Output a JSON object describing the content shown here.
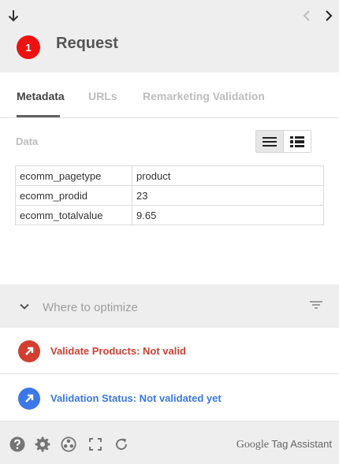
{
  "header": {
    "back_icon": "arrow-down-icon",
    "prev_icon": "chevron-left-icon",
    "next_icon": "chevron-right-icon",
    "badge_number": "1",
    "title": "Request",
    "badge_color": "#ee1111"
  },
  "tabs": [
    {
      "label": "Metadata",
      "active": true
    },
    {
      "label": "URLs",
      "active": false
    },
    {
      "label": "Remarketing Validation",
      "active": false
    }
  ],
  "data_section": {
    "label": "Data",
    "view_modes": [
      "compact-list-icon",
      "detailed-list-icon"
    ],
    "rows": [
      {
        "key": "ecomm_pagetype",
        "value": "product"
      },
      {
        "key": "ecomm_prodid",
        "value": "23"
      },
      {
        "key": "ecomm_totalvalue",
        "value": "9.65"
      }
    ]
  },
  "optimize": {
    "label": "Where to optimize",
    "chevron_icon": "chevron-down-icon",
    "filter_icon": "filter-icon"
  },
  "statuses": [
    {
      "text": "Validate Products: Not valid",
      "color": "#d23f31",
      "icon": "arrow-up-right-icon"
    },
    {
      "text": "Validation Status: Not validated yet",
      "color": "#3b78e7",
      "icon": "arrow-down-right-icon"
    }
  ],
  "footer": {
    "icons": [
      "help-icon",
      "settings-icon",
      "record-icon",
      "fullscreen-icon",
      "refresh-icon"
    ],
    "brand_google": "Google",
    "brand_product": "Tag Assistant"
  }
}
